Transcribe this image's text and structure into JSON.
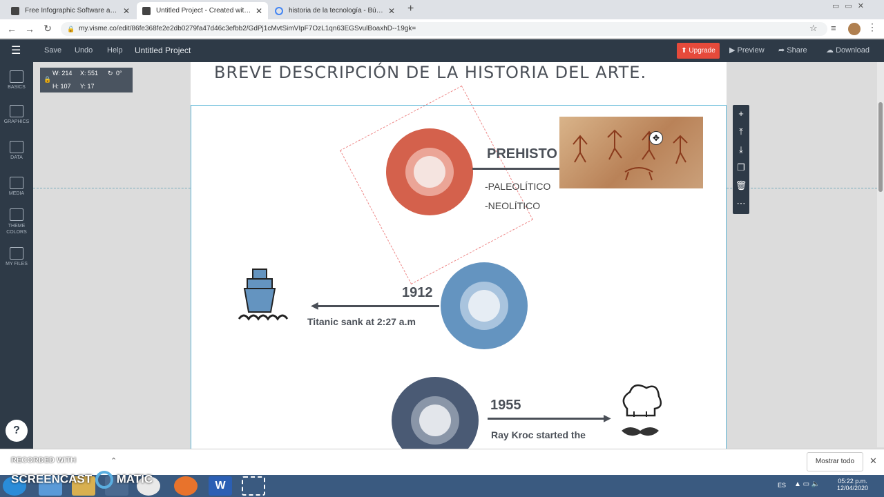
{
  "browser": {
    "tabs": [
      {
        "title": "Free Infographic Software and P"
      },
      {
        "title": "Untitled Project - Created with V"
      },
      {
        "title": "historia de la tecnología - Búsqu"
      }
    ],
    "url": "my.visme.co/edit/86fe368fe2e2db0279fa47d46c3efbb2/GdPj1cMvtSimVIpF7OzL1qn63EGSvulBoaxhD--19gk="
  },
  "toolbar": {
    "save": "Save",
    "undo": "Undo",
    "help": "Help",
    "project": "Untitled Project",
    "upgrade": "Upgrade",
    "preview": "Preview",
    "share": "Share",
    "download": "Download"
  },
  "sidebar": {
    "items": [
      {
        "label": "BASICS"
      },
      {
        "label": "GRAPHICS"
      },
      {
        "label": "DATA"
      },
      {
        "label": "MEDIA"
      },
      {
        "label": "THEME COLORS"
      },
      {
        "label": "MY FILES"
      }
    ]
  },
  "dims": {
    "w": "W: 214",
    "x": "X: 551",
    "rot": "0°",
    "h": "H: 107",
    "y": "Y: 17"
  },
  "slide": {
    "title": "BREVE DESCRIPCIÓN DE LA HISTORIA DEL ARTE.",
    "prehistoria": {
      "heading": "PREHISTO",
      "items": [
        "-PALEOLÍTICO",
        "-NEOLÍTICO"
      ]
    },
    "event1": {
      "year": "1912",
      "caption": "Titanic sank at 2:27 a.m"
    },
    "event2": {
      "year": "1955",
      "caption": "Ray Kroc started the"
    }
  },
  "bottom": {
    "recorded": "RECORDED WITH",
    "brand": "SCREENCAST",
    "brand2": "MATIC",
    "show_all": "Mostrar todo"
  },
  "taskbar": {
    "lang": "ES",
    "time": "05:22 p.m.",
    "date": "12/04/2020"
  },
  "colors": {
    "red": "#d4614c",
    "blue": "#6494c0",
    "navy": "#4a5a74",
    "upgrade": "#e64a3b"
  }
}
